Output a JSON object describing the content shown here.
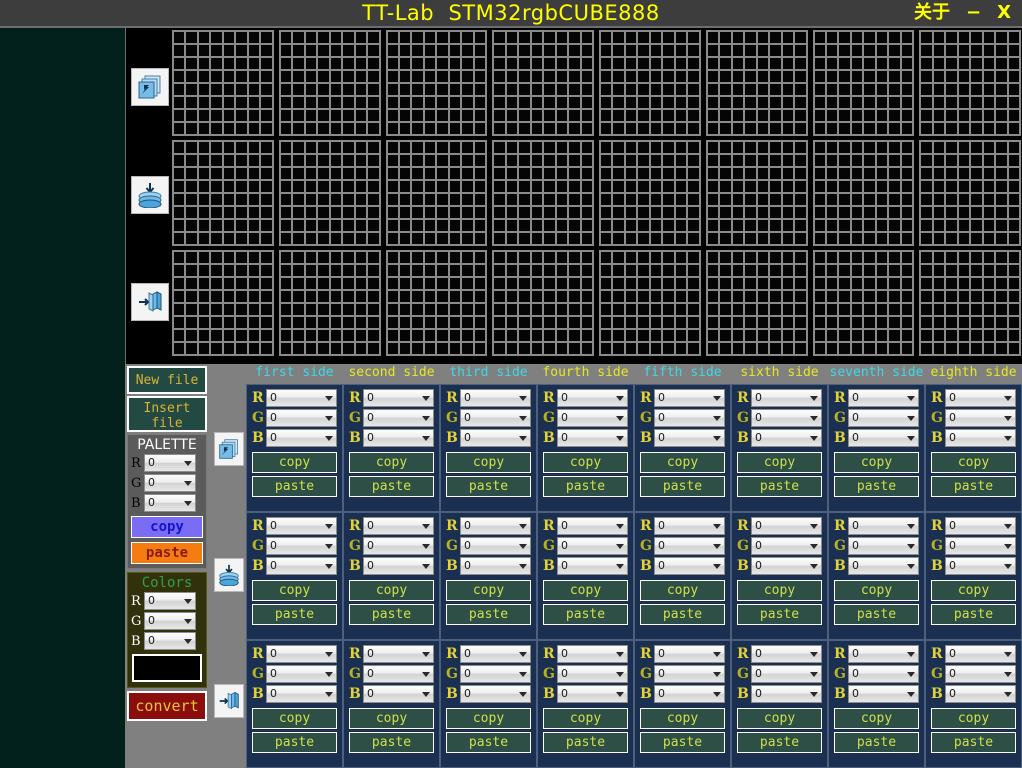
{
  "titlebar": {
    "title": "TT-Lab  STM32rgbCUBE888",
    "about_label": "关于",
    "minimize_label": "−",
    "close_label": "X"
  },
  "grid": {
    "rows": 3,
    "cols": 8,
    "block_size": 8,
    "cell_color": "#050505",
    "gridline_color": "#8a8a8a",
    "icons": [
      "layers-select-icon",
      "layers-down-icon",
      "layers-right-icon"
    ]
  },
  "left_panel": {
    "new_file_label": "New file",
    "insert_file_label": "Insert\nfile",
    "palette": {
      "title": "PALETTE",
      "channels": [
        {
          "label": "R",
          "value": "0"
        },
        {
          "label": "G",
          "value": "0"
        },
        {
          "label": "B",
          "value": "0"
        }
      ],
      "copy_label": "copy",
      "paste_label": "paste",
      "copy_bg": "#7b6cf6",
      "paste_bg": "#f57c10"
    },
    "colors": {
      "title": "Colors",
      "channels": [
        {
          "label": "R",
          "value": "0"
        },
        {
          "label": "G",
          "value": "0"
        },
        {
          "label": "B",
          "value": "0"
        }
      ],
      "swatch_color": "#000000"
    },
    "convert_label": "convert",
    "convert_bg": "#8b0d0d"
  },
  "side_icons": [
    "layers-select-icon",
    "layers-down-icon",
    "layers-right-icon"
  ],
  "matrix": {
    "headers": [
      {
        "label": "first side",
        "color": "#3dd8e8"
      },
      {
        "label": "second side",
        "color": "#e8e81f"
      },
      {
        "label": "third side",
        "color": "#3dd8e8"
      },
      {
        "label": "fourth side",
        "color": "#e8e81f"
      },
      {
        "label": "fifth side",
        "color": "#3dd8e8"
      },
      {
        "label": "sixth side",
        "color": "#e8e81f"
      },
      {
        "label": "seventh side",
        "color": "#3dd8e8"
      },
      {
        "label": "eighth side",
        "color": "#e8e81f"
      }
    ],
    "rows": 3,
    "cols": 8,
    "cell": {
      "r_label": "R",
      "g_label": "G",
      "b_label": "B",
      "r_value": "0",
      "g_value": "0",
      "b_value": "0",
      "copy_label": "copy",
      "paste_label": "paste"
    },
    "cell_bg": "#1b3050",
    "button_bg": "#2e4f45",
    "button_text_color": "#cfe04a"
  }
}
